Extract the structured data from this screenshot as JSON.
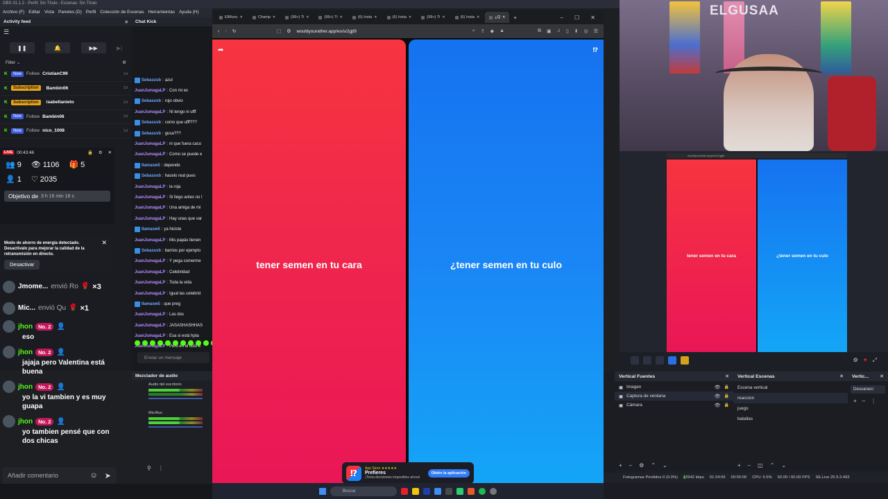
{
  "obs": {
    "title": "OBS 31.1.2 - Perfil: Sin Título - Escenas: Sin Título",
    "menu": [
      "Archivo (F)",
      "Editar",
      "Vista",
      "Paneles (D)",
      "Perfil",
      "Colección de Escenas",
      "Herramientas",
      "Ayuda (H)"
    ]
  },
  "activity_feed": {
    "title": "Activity feed",
    "filter_label": "Filter",
    "rows": [
      {
        "badge": "New",
        "type": "Follow",
        "user": "CristianC99",
        "age": "1d"
      },
      {
        "badge": "Subscription",
        "type": "",
        "user": "Bambin06",
        "age": "1d"
      },
      {
        "badge": "Subscription",
        "type": "",
        "user": "isabellanieto",
        "age": "1d"
      },
      {
        "badge": "New",
        "type": "Follow",
        "user": "Bambin06",
        "age": "1d"
      },
      {
        "badge": "New",
        "type": "Follow",
        "user": "nico_1008",
        "age": "1d"
      }
    ]
  },
  "live_overlay": {
    "live_tag": "LIVE",
    "timer": "00:43:46",
    "viewers": "9",
    "views": "1106",
    "gifts": "5",
    "followers": "1",
    "likes": "2035",
    "objective": "Objetivo de",
    "objective_time": "3 h 16 min 18 s"
  },
  "energy_notice": {
    "text": "Modo de ahorro de energía detectado. Desactívalo para mejorar la calidad de la retransmisión en directo.",
    "button": "Desactivar"
  },
  "gifts": [
    {
      "user": "Jmome...",
      "action": "envió Ro",
      "count": "×3"
    },
    {
      "user": "Mic...",
      "action": "envió Qu",
      "count": "×1"
    }
  ],
  "kick_chat": [
    {
      "user": "jhon",
      "badge": "No. 2",
      "msg": "eso"
    },
    {
      "user": "jhon",
      "badge": "No. 2",
      "msg": "jajaja pero Valentina está buena"
    },
    {
      "user": "jhon",
      "badge": "No. 2",
      "msg": "yo la vi tambien y es muy guapa"
    },
    {
      "user": "jhon",
      "badge": "No. 2",
      "msg": "yo tambien pensé que con dos chicas"
    }
  ],
  "comment_placeholder": "Añadir comentario",
  "chat_kick": {
    "title": "Chat Kick",
    "input_placeholder": "Enviar un mensaje",
    "lines": [
      {
        "user": "Sebassvb",
        "text": "azul",
        "c": "u1",
        "icon": true
      },
      {
        "user": "JuanJumagaLP",
        "text": "Con mi ex",
        "c": "u2",
        "icon": false
      },
      {
        "user": "Sebassvb",
        "text": "rojo obvio",
        "c": "u1",
        "icon": true
      },
      {
        "user": "JuanJumagaLP",
        "text": "Ni tengo ni ufff",
        "c": "u2",
        "icon": false
      },
      {
        "user": "Sebassvb",
        "text": "como que ufff???",
        "c": "u1",
        "icon": true
      },
      {
        "user": "Sebassvb",
        "text": "gusa???",
        "c": "u1",
        "icon": true
      },
      {
        "user": "JuanJumagaLP",
        "text": "ni que fuera caco",
        "c": "u2",
        "icon": false
      },
      {
        "user": "JuanJumagaLP",
        "text": "Como se puede e",
        "c": "u2",
        "icon": false
      },
      {
        "user": "Ilamasw5",
        "text": "depende",
        "c": "u1",
        "icon": true
      },
      {
        "user": "Sebassvb",
        "text": "hacelo real pues",
        "c": "u1",
        "icon": true
      },
      {
        "user": "JuanJumagaLP",
        "text": "la roja",
        "c": "u2",
        "icon": false
      },
      {
        "user": "JuanJumagaLP",
        "text": "Si llego antes no l",
        "c": "u2",
        "icon": false
      },
      {
        "user": "JuanJumagaLP",
        "text": "Una amiga de mi",
        "c": "u2",
        "icon": false
      },
      {
        "user": "JuanJumagaLP",
        "text": "Hay unas que var",
        "c": "u2",
        "icon": false
      },
      {
        "user": "Ilamasw5",
        "text": "ya hiciste",
        "c": "u1",
        "icon": true
      },
      {
        "user": "JuanJumagaLP",
        "text": "Mis papás tienen",
        "c": "u2",
        "icon": false
      },
      {
        "user": "Sebassvb",
        "text": "barrios por ejemplo",
        "c": "u1",
        "icon": true
      },
      {
        "user": "JuanJumagaLP",
        "text": "Y pega comerme",
        "c": "u2",
        "icon": false
      },
      {
        "user": "JuanJumagaLP",
        "text": "Celebridad",
        "c": "u2",
        "icon": false
      },
      {
        "user": "JuanJumagaLP",
        "text": "Toda la vida",
        "c": "u2",
        "icon": false
      },
      {
        "user": "JuanJumagaLP",
        "text": "Igual las celebrid",
        "c": "u2",
        "icon": false
      },
      {
        "user": "Ilamasw5",
        "text": "que preg",
        "c": "u1",
        "icon": true
      },
      {
        "user": "JuanJumagaLP",
        "text": "Las dos",
        "c": "u2",
        "icon": false
      },
      {
        "user": "JuanJumagaLP",
        "text": "JASASHASHHAS",
        "c": "u2",
        "icon": false
      },
      {
        "user": "JuanJumagaLP",
        "text": "Esa si está hpta",
        "c": "u2",
        "icon": false
      },
      {
        "user": "JuanJumagaLP",
        "text": "Pero en el culo e",
        "c": "u2",
        "icon": false
      }
    ]
  },
  "mixer": {
    "title": "Mezclador de audio",
    "tracks": [
      {
        "name": "Audio del escritorio"
      },
      {
        "name": "Mic/Aux"
      }
    ]
  },
  "browser": {
    "tabs": [
      "ElMunc",
      "Champ",
      "(99+) Ti",
      "(99+) Ti",
      "(6) Insta",
      "(6) Insta",
      "(99+) Ti",
      "(6) Insta",
      "¿Q"
    ],
    "url": "wouldyourather.app/es/s/2gjt9"
  },
  "game": {
    "option_a": "tener semen en tu cara",
    "option_b": "¿tener semen en tu culo"
  },
  "app_banner": {
    "store": "App Store ★★★★★",
    "name": "Prefieres",
    "tagline": "¡Toma decisiones imposibles ahora!",
    "button": "Obtén la aplicación"
  },
  "taskbar": {
    "search": "Buscar"
  },
  "webcam": {
    "overlay_title": "ELGUSAA"
  },
  "vertical_preview": {
    "url": "wouldyourather.app/es/s/2gjt9",
    "option_a": "tener semen en tu cara",
    "option_b": "¿tener semen en tu culo"
  },
  "docks": {
    "fuentes_title": "Vertical Fuentes",
    "fuentes": [
      "Imagen",
      "Captura de ventana",
      "Cámara"
    ],
    "escenas_title": "Vertical Escenas",
    "escenas": [
      "Escena vertical",
      "reaccion",
      "juego",
      "batallas"
    ],
    "vert_title": "Vertic...",
    "transition": "Desvaneci"
  },
  "status": {
    "frames_lost": "Fotogramas Perdidos 0 (0.0%)",
    "bitrate": "2642 kbps",
    "rec_time": "01:24:09",
    "stream_time": "00:00:00",
    "cpu": "CPU: 6.5%",
    "fps": "60.00 / 60.00 FPS",
    "version": "SE.Live 25.9.3.493"
  },
  "colors": {
    "red_option": "#ef2448",
    "blue_option": "#1a86f5",
    "kick_green": "#53fc18"
  }
}
